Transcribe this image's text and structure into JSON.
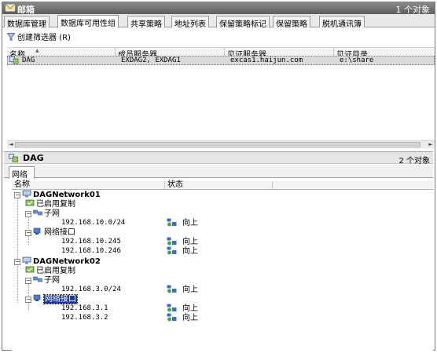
{
  "window": {
    "title": "邮箱",
    "object_count": "1 个对象"
  },
  "tabs": [
    {
      "label": "数据库管理",
      "active": false
    },
    {
      "label": "数据库可用性组",
      "active": true
    },
    {
      "label": "共享策略",
      "active": false
    },
    {
      "label": "地址列表",
      "active": false
    },
    {
      "label": "保留策略标记",
      "active": false
    },
    {
      "label": "保留策略",
      "active": false
    },
    {
      "label": "脱机通讯簿",
      "active": false
    }
  ],
  "toolbar": {
    "create_filter_label": "创建筛选器 (R)"
  },
  "list": {
    "columns": [
      "名称",
      "成员服务器",
      "见证服务器",
      "见证目录"
    ],
    "sort_indicator": "▲",
    "rows": [
      {
        "name": "DAG",
        "members": "EXDAG2, EXDAG1",
        "witness_server": "excas1.haijun.com",
        "witness_dir": "e:\\share"
      }
    ],
    "scroll_left": "◄",
    "scroll_right": "►"
  },
  "details": {
    "title": "DAG",
    "object_count": "2 个对象",
    "tab_label": "网络",
    "columns": [
      "名称",
      "状态"
    ],
    "tree": [
      {
        "label": "DAGNetwork01",
        "bold": true
      },
      {
        "label": "已启用复制"
      },
      {
        "label": "子网"
      },
      {
        "label": "192.168.10.0/24",
        "status": "向上"
      },
      {
        "label": "网络接口"
      },
      {
        "label": "192.168.10.245",
        "status": "向上"
      },
      {
        "label": "192.168.10.246",
        "status": "向上"
      },
      {
        "label": "DAGNetwork02",
        "bold": true
      },
      {
        "label": "已启用复制"
      },
      {
        "label": "子网"
      },
      {
        "label": "192.168.3.0/24",
        "status": "向上"
      },
      {
        "label": "网络接口",
        "selected": true
      },
      {
        "label": "192.168.3.1",
        "status": "向上"
      },
      {
        "label": "192.168.3.2",
        "status": "向上"
      }
    ],
    "toggle_symbol": "−"
  },
  "colors": {
    "title_bar": "#6f6f6f",
    "selection": "#1c3c92",
    "row_highlight": "#d9d9d9"
  }
}
